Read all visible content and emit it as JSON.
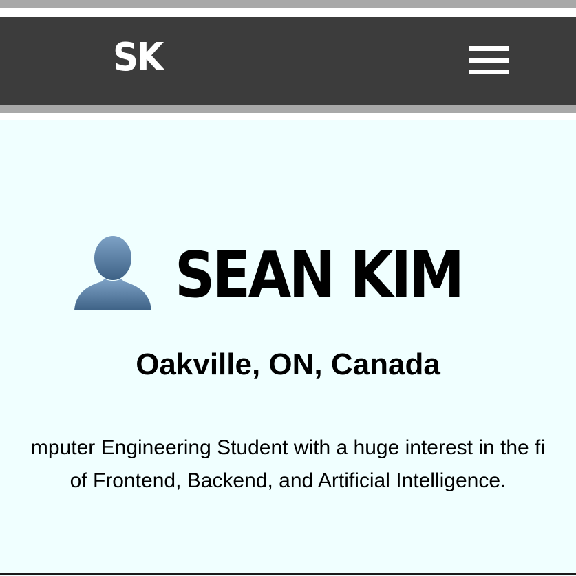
{
  "header": {
    "logo_text": "SK",
    "menu_icon": "hamburger-menu-icon"
  },
  "hero": {
    "avatar_icon": "person-silhouette-icon",
    "name": "SEAN KIM",
    "location": "Oakville, ON, Canada",
    "bio_line1": "mputer Engineering Student with a huge interest in the fi",
    "bio_line2": "of Frontend, Backend, and Artificial Intelligence."
  },
  "colors": {
    "navbar_bg": "#3c3c3c",
    "strip": "#a8a8a8",
    "page_bg": "#f0ffff",
    "text": "#000000",
    "avatar": "#5a7ea3"
  }
}
